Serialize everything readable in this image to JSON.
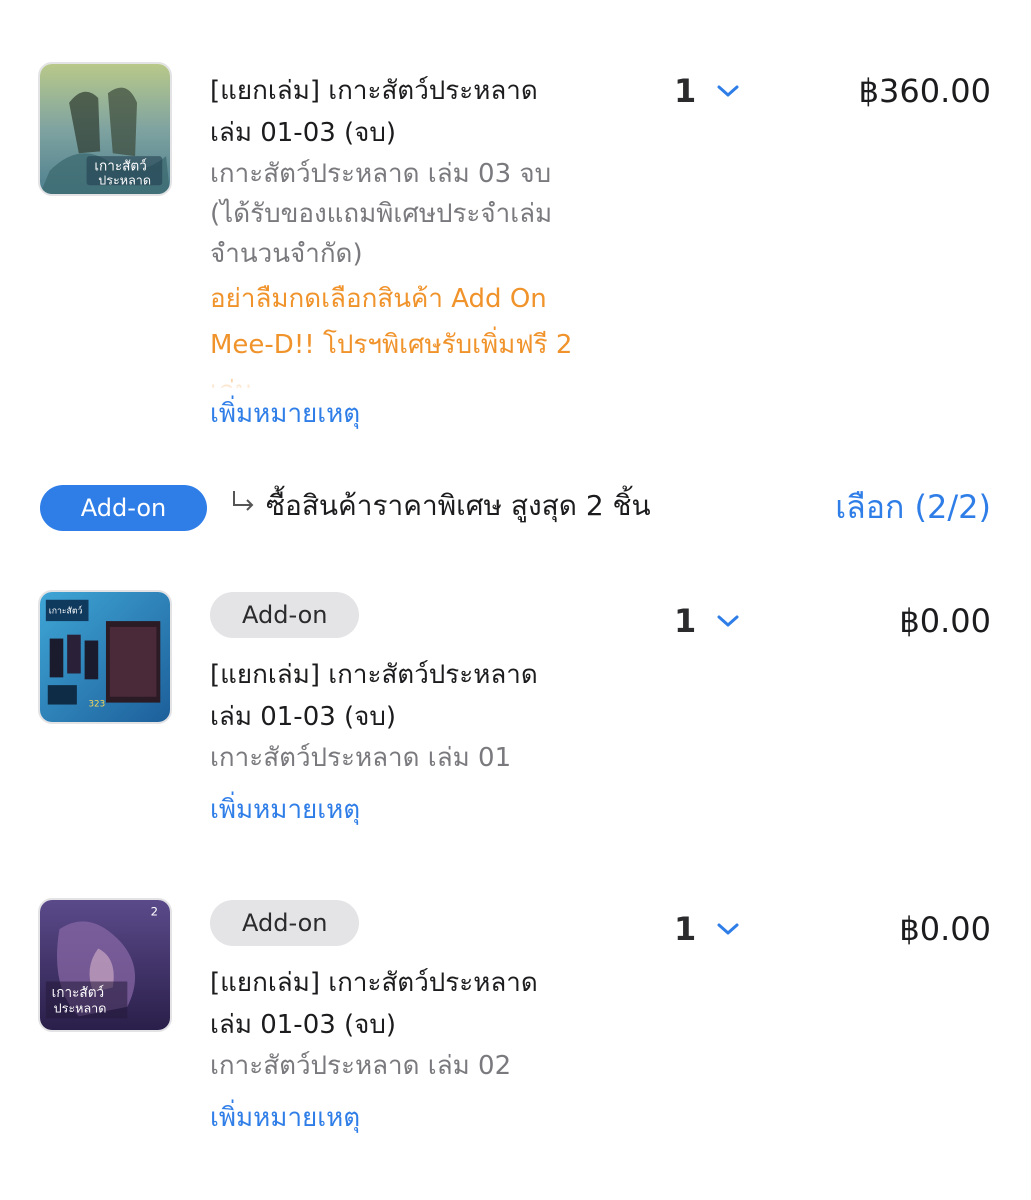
{
  "items": [
    {
      "title_line1": "[แยกเล่ม] เกาะสัตว์ประหลาด",
      "title_line2": "เล่ม 01-03 (จบ)",
      "variant_lines": [
        "เกาะสัตว์ประหลาด เล่ม 03 จบ",
        "(ได้รับของแถมพิเศษประจำเล่ม",
        "จำนวนจำกัด)"
      ],
      "promo_lines": [
        "อย่าลืมกดเลือกสินค้า Add On",
        "Mee-D!! โปรฯพิเศษรับเพิ่มฟรี 2",
        "เล่ม"
      ],
      "note_link": "เพิ่มหมายเหตุ",
      "qty": "1",
      "price": "฿360.00"
    },
    {
      "badge": "Add-on",
      "title_line1": "[แยกเล่ม] เกาะสัตว์ประหลาด",
      "title_line2": "เล่ม 01-03 (จบ)",
      "variant": "เกาะสัตว์ประหลาด เล่ม 01",
      "note_link": "เพิ่มหมายเหตุ",
      "qty": "1",
      "price": "฿0.00"
    },
    {
      "badge": "Add-on",
      "title_line1": "[แยกเล่ม] เกาะสัตว์ประหลาด",
      "title_line2": "เล่ม 01-03 (จบ)",
      "variant": "เกาะสัตว์ประหลาด เล่ม 02",
      "note_link": "เพิ่มหมายเหตุ",
      "qty": "1",
      "price": "฿0.00"
    }
  ],
  "addon_bar": {
    "pill_label": "Add-on",
    "description": "ซื้อสินค้าราคาพิเศษ สูงสุด 2 ชิ้น",
    "select_label": "เลือก (2/2)"
  },
  "colors": {
    "accent_blue": "#2f7ee8",
    "promo_orange": "#f0932b",
    "muted_text": "#7a7a7e",
    "badge_bg": "#e4e4e6"
  },
  "icons": {
    "quantity_dropdown": "chevron-down-icon",
    "addon_arrow": "return-arrow-icon"
  }
}
